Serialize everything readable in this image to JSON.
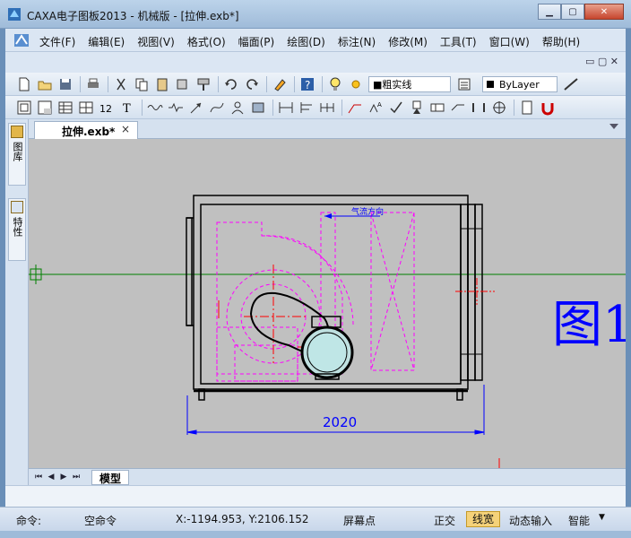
{
  "window": {
    "title": "CAXA电子图板2013 - 机械版 - [拉伸.exb*]",
    "minimize_label": "▁",
    "maximize_label": "▢",
    "close_label": "✕"
  },
  "menubar": {
    "items": [
      {
        "label": "文件(F)"
      },
      {
        "label": "编辑(E)"
      },
      {
        "label": "视图(V)"
      },
      {
        "label": "格式(O)"
      },
      {
        "label": "幅面(P)"
      },
      {
        "label": "绘图(D)"
      },
      {
        "label": "标注(N)"
      },
      {
        "label": "修改(M)"
      },
      {
        "label": "工具(T)"
      },
      {
        "label": "窗口(W)"
      },
      {
        "label": "帮助(H)"
      }
    ],
    "mdi_controls": "▭ ▢ ✕"
  },
  "toolbar1": {
    "linetype": "■粗实线",
    "layer": "ByLayer"
  },
  "side_panel": {
    "tabs": [
      {
        "label": "图库"
      },
      {
        "label": "特性"
      }
    ]
  },
  "document": {
    "tab_label": "拉伸.exb*",
    "tab_close": "×"
  },
  "drawing": {
    "airflow_label": "气流方向",
    "dimension_value": "2020",
    "handwritten_text": "图1"
  },
  "model_bar": {
    "tab_label": "模型",
    "nav": [
      "⏮",
      "◀",
      "▶",
      "⏭"
    ]
  },
  "statusbar": {
    "command_label": "命令:",
    "command_value": "空命令",
    "coords": "X:-1194.953, Y:2106.152",
    "screen_point": "屏幕点",
    "ortho": "正交",
    "line_width": "线宽",
    "dynamic_input": "动态输入",
    "smart": "智能"
  },
  "colors": {
    "canvas_bg": "#c0c0c0",
    "magenta": "#ff00ff",
    "red": "#ff0000",
    "blue": "#0000ff",
    "axis_green": "#008000"
  }
}
